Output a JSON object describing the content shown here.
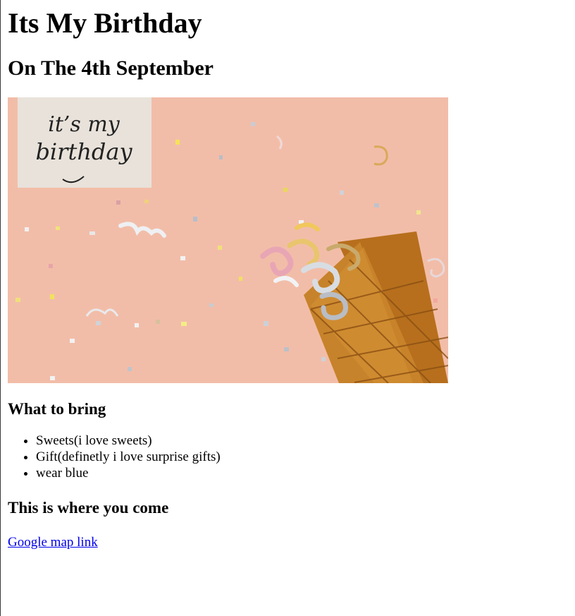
{
  "page": {
    "title": "Its My Birthday",
    "subtitle": "On The 4th September",
    "bring_heading": "What to bring",
    "bring_items": [
      "Sweets(i love sweets)",
      "Gift(definetly i love surprise gifts)",
      "wear blue"
    ],
    "location_heading": "This is where you come",
    "map_link_label": "Google map link"
  },
  "image": {
    "card_text": "it's my birthday"
  },
  "colors": {
    "link": "#0000ee",
    "image_background": "#f0b9a4"
  }
}
